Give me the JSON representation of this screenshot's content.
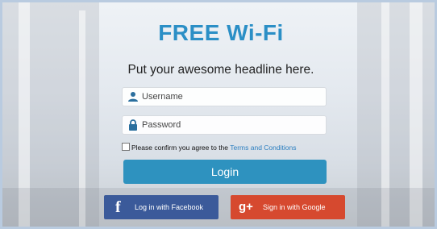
{
  "header": {
    "title": "FREE Wi-Fi",
    "headline": "Put your awesome headline here."
  },
  "form": {
    "username_placeholder": "Username",
    "password_placeholder": "Password",
    "agree_prefix": "Please confirm you agree to the ",
    "agree_link": "Terms and Conditions",
    "login_label": "Login"
  },
  "social": {
    "facebook_label": "Log in with Facebook",
    "facebook_glyph": "f",
    "google_label": "Sign in with Google",
    "google_glyph": "g+"
  },
  "colors": {
    "title": "#2b8fc6",
    "login": "#2e92bf",
    "facebook": "#3b5a9a",
    "google": "#d6492f"
  },
  "icons": {
    "username": "user-icon",
    "password": "lock-icon"
  }
}
